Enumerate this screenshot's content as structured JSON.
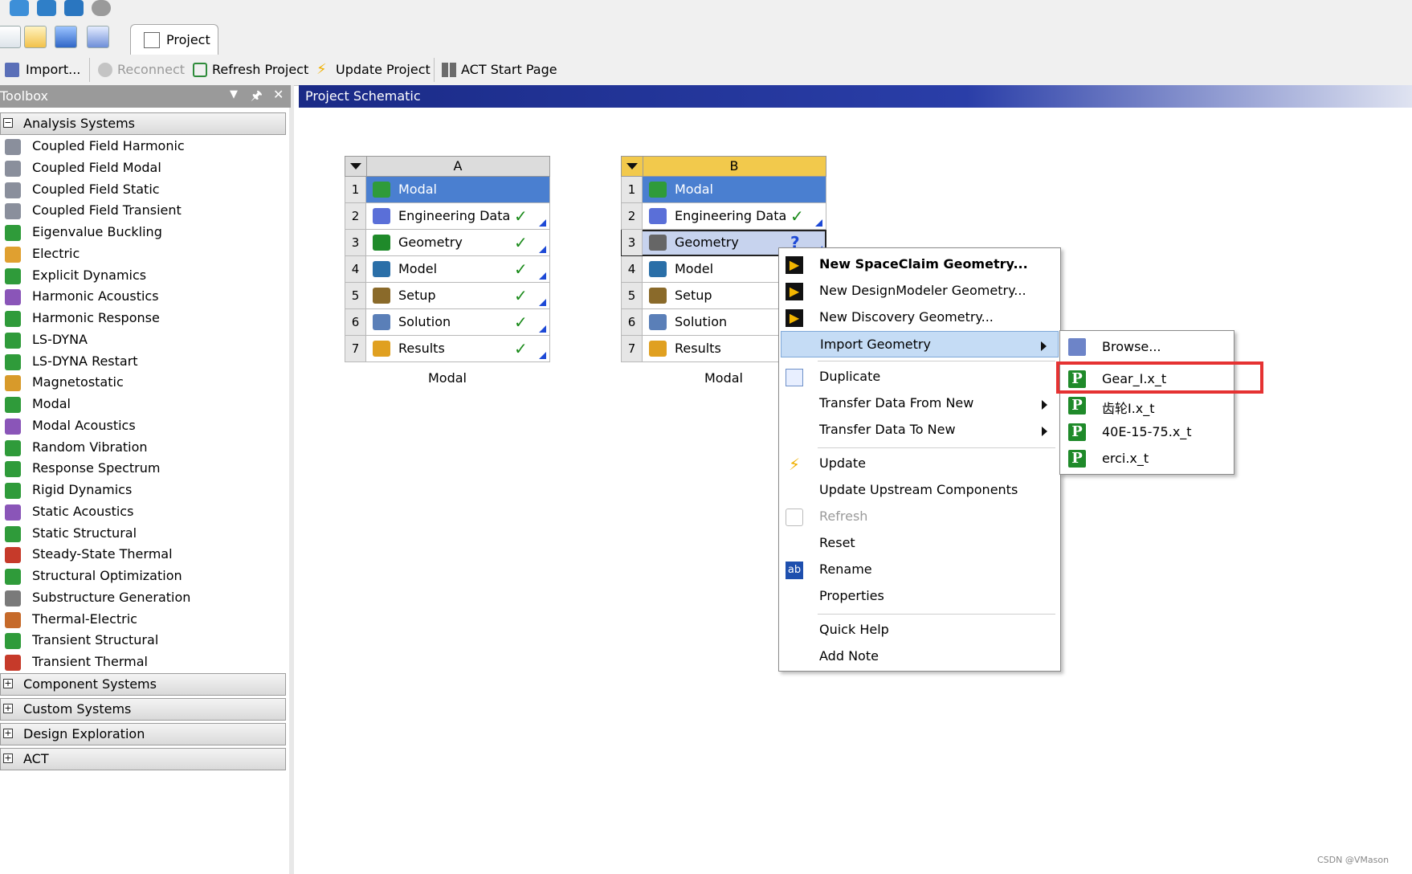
{
  "tabs": {
    "project": "Project"
  },
  "toolbar": {
    "import": "Import...",
    "reconnect": "Reconnect",
    "refresh_project": "Refresh Project",
    "update_project": "Update Project",
    "act_start_page": "ACT Start Page"
  },
  "toolbox": {
    "title": "Toolbox",
    "analysis_group": "Analysis Systems",
    "items": [
      {
        "label": "Coupled Field Harmonic",
        "icon": "coupled-field-icon"
      },
      {
        "label": "Coupled Field Modal",
        "icon": "coupled-field-icon"
      },
      {
        "label": "Coupled Field Static",
        "icon": "coupled-field-icon"
      },
      {
        "label": "Coupled Field Transient",
        "icon": "coupled-field-icon"
      },
      {
        "label": "Eigenvalue Buckling",
        "icon": "buckling-icon"
      },
      {
        "label": "Electric",
        "icon": "electric-icon"
      },
      {
        "label": "Explicit Dynamics",
        "icon": "explicit-dynamics-icon"
      },
      {
        "label": "Harmonic Acoustics",
        "icon": "acoustics-icon"
      },
      {
        "label": "Harmonic Response",
        "icon": "harmonic-response-icon"
      },
      {
        "label": "LS-DYNA",
        "icon": "ls-dyna-icon"
      },
      {
        "label": "LS-DYNA Restart",
        "icon": "ls-dyna-icon"
      },
      {
        "label": "Magnetostatic",
        "icon": "magnetostatic-icon"
      },
      {
        "label": "Modal",
        "icon": "modal-icon"
      },
      {
        "label": "Modal Acoustics",
        "icon": "acoustics-icon"
      },
      {
        "label": "Random Vibration",
        "icon": "random-vibration-icon"
      },
      {
        "label": "Response Spectrum",
        "icon": "response-spectrum-icon"
      },
      {
        "label": "Rigid Dynamics",
        "icon": "rigid-dynamics-icon"
      },
      {
        "label": "Static Acoustics",
        "icon": "acoustics-icon"
      },
      {
        "label": "Static Structural",
        "icon": "static-structural-icon"
      },
      {
        "label": "Steady-State Thermal",
        "icon": "thermal-icon"
      },
      {
        "label": "Structural Optimization",
        "icon": "optimization-icon"
      },
      {
        "label": "Substructure Generation",
        "icon": "substructure-icon"
      },
      {
        "label": "Thermal-Electric",
        "icon": "thermal-electric-icon"
      },
      {
        "label": "Transient Structural",
        "icon": "transient-structural-icon"
      },
      {
        "label": "Transient Thermal",
        "icon": "thermal-icon"
      }
    ],
    "groups": [
      "Component Systems",
      "Custom Systems",
      "Design Exploration",
      "ACT"
    ]
  },
  "schematic": {
    "title": "Project Schematic",
    "systems": [
      {
        "letter": "A",
        "caption": "Modal",
        "rows": [
          {
            "num": "1",
            "label": "Modal",
            "icon": "modal-icon",
            "status": ""
          },
          {
            "num": "2",
            "label": "Engineering Data",
            "icon": "engineering-data-icon",
            "status": "✓"
          },
          {
            "num": "3",
            "label": "Geometry",
            "icon": "geometry-p-icon",
            "status": "✓"
          },
          {
            "num": "4",
            "label": "Model",
            "icon": "model-icon",
            "status": "✓"
          },
          {
            "num": "5",
            "label": "Setup",
            "icon": "setup-icon",
            "status": "✓"
          },
          {
            "num": "6",
            "label": "Solution",
            "icon": "solution-icon",
            "status": "✓"
          },
          {
            "num": "7",
            "label": "Results",
            "icon": "results-icon",
            "status": "✓"
          }
        ]
      },
      {
        "letter": "B",
        "caption": "Modal",
        "rows": [
          {
            "num": "1",
            "label": "Modal",
            "icon": "modal-icon",
            "status": ""
          },
          {
            "num": "2",
            "label": "Engineering Data",
            "icon": "engineering-data-icon",
            "status": "✓"
          },
          {
            "num": "3",
            "label": "Geometry",
            "icon": "geometry-cube-icon",
            "status": "?"
          },
          {
            "num": "4",
            "label": "Model",
            "icon": "model-icon",
            "status": ""
          },
          {
            "num": "5",
            "label": "Setup",
            "icon": "setup-icon",
            "status": ""
          },
          {
            "num": "6",
            "label": "Solution",
            "icon": "solution-icon",
            "status": ""
          },
          {
            "num": "7",
            "label": "Results",
            "icon": "results-icon",
            "status": ""
          }
        ]
      }
    ]
  },
  "context_menu": {
    "new_spaceclaim": "New SpaceClaim Geometry...",
    "new_designmodeler": "New DesignModeler Geometry...",
    "new_discovery": "New Discovery Geometry...",
    "import_geometry": "Import Geometry",
    "duplicate": "Duplicate",
    "transfer_from_new": "Transfer Data From New",
    "transfer_to_new": "Transfer Data To New",
    "update": "Update",
    "update_upstream": "Update Upstream Components",
    "refresh": "Refresh",
    "reset": "Reset",
    "rename": "Rename",
    "properties": "Properties",
    "quick_help": "Quick Help",
    "add_note": "Add Note"
  },
  "submenu": {
    "browse": "Browse...",
    "files": [
      "Gear_I.x_t",
      "齿轮I.x_t",
      "40E-15-75.x_t",
      "erci.x_t"
    ]
  },
  "watermark": "CSDN @VMason",
  "colors": {
    "schematic_header": "#1a2a86",
    "selected_row": "#4a7fd0",
    "highlight_box": "#e53232",
    "check": "#1a8a1a"
  }
}
